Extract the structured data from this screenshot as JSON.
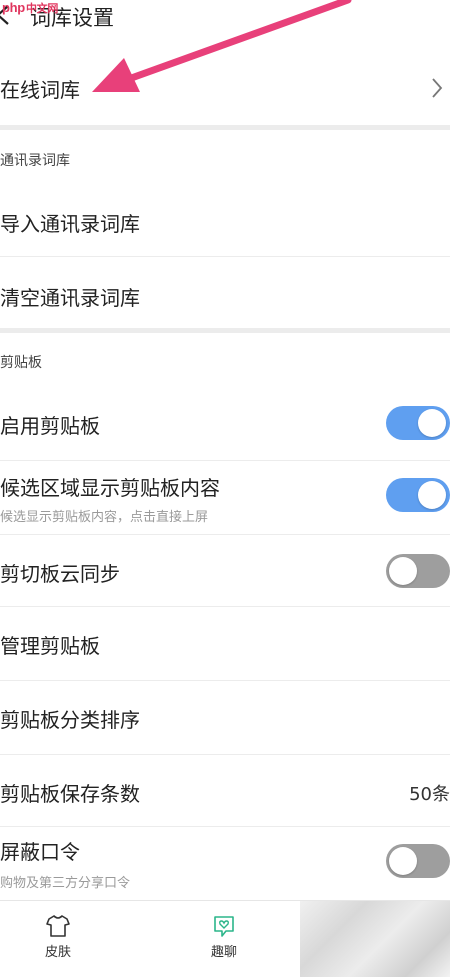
{
  "header": {
    "title": "词库设置",
    "watermark_latin": "php",
    "watermark_cn": "中文网"
  },
  "online_lexicon": {
    "label": "在线词库"
  },
  "contacts_section": {
    "title": "通讯录词库",
    "import_label": "导入通讯录词库",
    "clear_label": "清空通讯录词库"
  },
  "clipboard_section": {
    "title": "剪贴板",
    "enable": {
      "label": "启用剪贴板",
      "on": true
    },
    "candidate": {
      "label": "候选区域显示剪贴板内容",
      "sub": "候选显示剪贴板内容，点击直接上屏",
      "on": true
    },
    "cloud_sync": {
      "label": "剪切板云同步",
      "on": false
    },
    "manage": {
      "label": "管理剪贴板"
    },
    "categorize": {
      "label": "剪贴板分类排序"
    },
    "save_count": {
      "label": "剪贴板保存条数",
      "value": "50条"
    },
    "block_password": {
      "label": "屏蔽口令",
      "sub": "购物及第三方分享口令",
      "on": false
    }
  },
  "bottom_nav": [
    {
      "label": "皮肤",
      "icon": "tshirt-icon"
    },
    {
      "label": "趣聊",
      "icon": "chat-heart-icon"
    }
  ],
  "colors": {
    "toggle_on": "#5f9ff0",
    "toggle_off": "#9e9e9e",
    "annotation_arrow": "#e8407a"
  }
}
